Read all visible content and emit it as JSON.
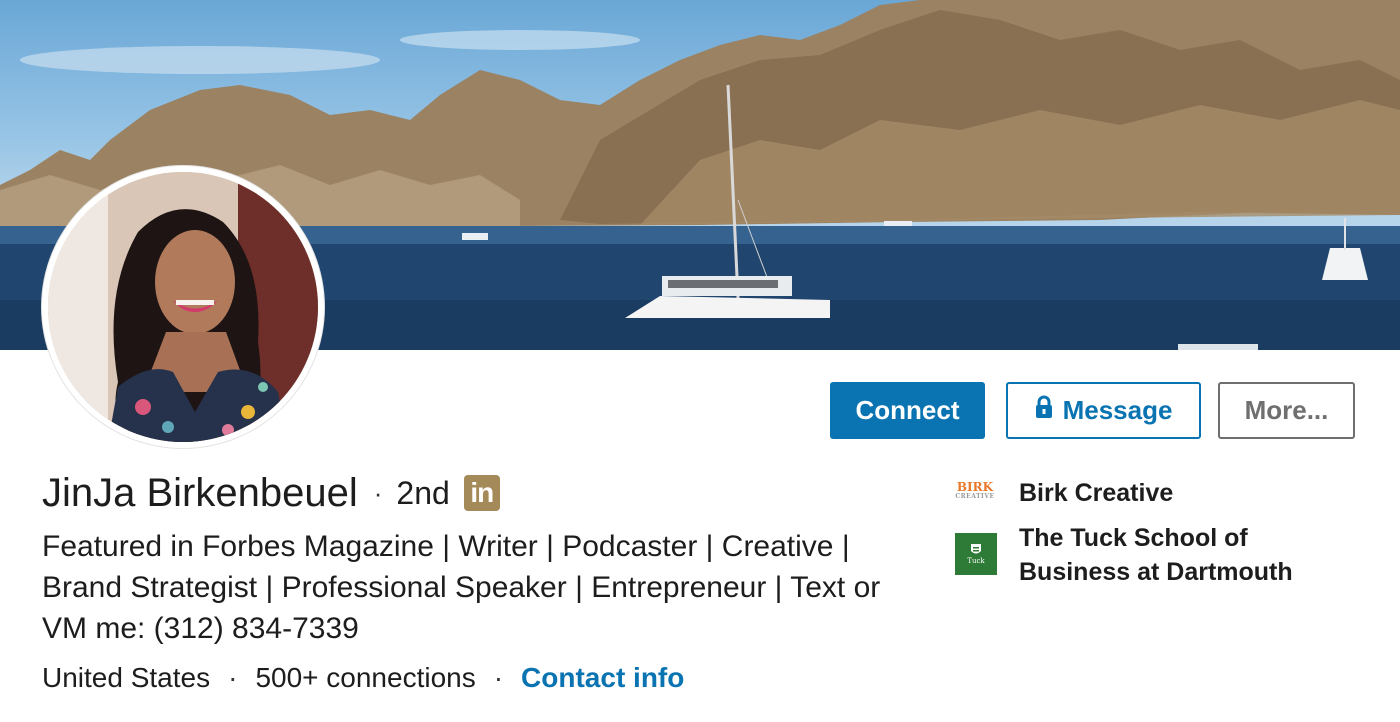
{
  "profile": {
    "name": "JinJa Birkenbeuel",
    "separator": "·",
    "degree": "2nd",
    "linkedin_badge": "in",
    "headline": "Featured in Forbes Magazine | Writer | Podcaster | Creative | Brand Strategist | Professional Speaker | Entrepreneur | Text or VM me: (312) 834-7339",
    "location": "United States",
    "connections": "500+ connections",
    "contact_label": "Contact info"
  },
  "actions": {
    "connect_label": "Connect",
    "message_label": "Message",
    "more_label": "More...",
    "message_icon": "lock-icon"
  },
  "organizations": [
    {
      "name": "Birk Creative",
      "logo_text": "BIRK",
      "logo_subtext": "CREATIVE",
      "logo_color": "#e8782b"
    },
    {
      "name": "The Tuck School of Business at Dartmouth",
      "logo_text": "Tuck",
      "logo_color": "#2d7b36"
    }
  ],
  "colors": {
    "primary": "#0a73b1",
    "linkedin_badge": "#a58a59",
    "secondary_border": "#6f6f6f"
  }
}
